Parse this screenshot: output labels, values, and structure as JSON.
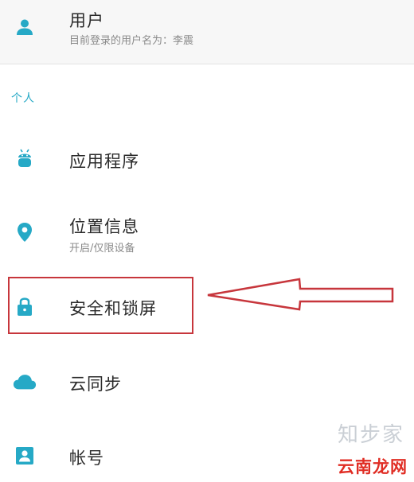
{
  "user": {
    "title": "用户",
    "subtitle": "目前登录的用户名为：李震",
    "icon": "person-icon"
  },
  "section_personal": "个人",
  "items": [
    {
      "label": "应用程序",
      "icon": "android-icon"
    },
    {
      "label": "位置信息",
      "sublabel": "开启/仅限设备",
      "icon": "location-pin-icon"
    },
    {
      "label": "安全和锁屏",
      "icon": "lock-icon"
    },
    {
      "label": "云同步",
      "icon": "cloud-icon"
    },
    {
      "label": "帐号",
      "icon": "account-box-icon"
    }
  ],
  "annotation": {
    "highlight_color": "#c7363c"
  },
  "watermark": {
    "top": "知步家",
    "bottom": "云南龙网"
  },
  "colors": {
    "accent": "#26a9c6"
  }
}
